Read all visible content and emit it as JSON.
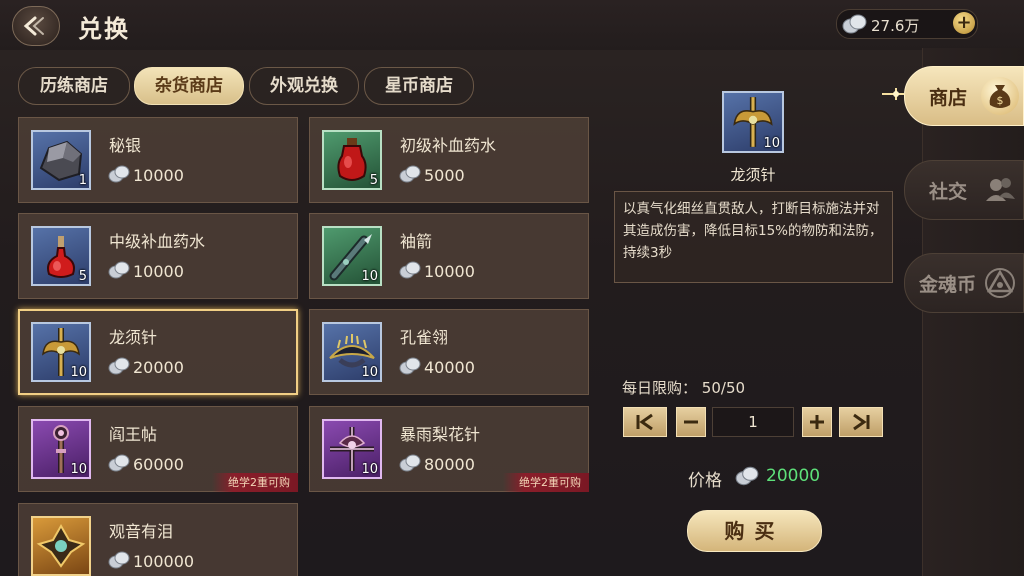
{
  "header": {
    "title": "兑换",
    "currency_amount": "27.6万"
  },
  "tabs": [
    {
      "label": "历练商店",
      "active": false
    },
    {
      "label": "杂货商店",
      "active": true
    },
    {
      "label": "外观兑换",
      "active": false
    },
    {
      "label": "星币商店",
      "active": false
    }
  ],
  "items": [
    {
      "name": "秘银",
      "price": "10000",
      "qty": "1",
      "rarity": "blue",
      "icon": "ore-icon",
      "selected": false,
      "lock": ""
    },
    {
      "name": "初级补血药水",
      "price": "5000",
      "qty": "5",
      "rarity": "green",
      "icon": "potion-icon",
      "selected": false,
      "lock": ""
    },
    {
      "name": "中级补血药水",
      "price": "10000",
      "qty": "5",
      "rarity": "blue",
      "icon": "potion-icon",
      "selected": false,
      "lock": ""
    },
    {
      "name": "袖箭",
      "price": "10000",
      "qty": "10",
      "rarity": "green",
      "icon": "sleeve-dart-icon",
      "selected": false,
      "lock": ""
    },
    {
      "name": "龙须针",
      "price": "20000",
      "qty": "10",
      "rarity": "blue",
      "icon": "needle-weapon-icon",
      "selected": true,
      "lock": ""
    },
    {
      "name": "孔雀翎",
      "price": "40000",
      "qty": "10",
      "rarity": "blue",
      "icon": "peacock-plume-icon",
      "selected": false,
      "lock": ""
    },
    {
      "name": "阎王帖",
      "price": "60000",
      "qty": "10",
      "rarity": "purple",
      "icon": "scepter-icon",
      "selected": false,
      "lock": "绝学2重可购"
    },
    {
      "name": "暴雨梨花针",
      "price": "80000",
      "qty": "10",
      "rarity": "purple",
      "icon": "needle-weapon-icon",
      "selected": false,
      "lock": "绝学2重可购"
    },
    {
      "name": "观音有泪",
      "price": "100000",
      "qty": "",
      "rarity": "orange",
      "icon": "ornament-icon",
      "selected": false,
      "lock": ""
    }
  ],
  "detail": {
    "name": "龙须针",
    "qty": "10",
    "description": "以真气化细丝直贯敌人，打断目标施法并对其造成伤害，降低目标15%的物防和法防，持续3秒",
    "daily_limit_label": "每日限购：",
    "daily_limit_value": "50/50",
    "quantity": "1",
    "price_label": "价格",
    "price_value": "20000",
    "buy_label": "购买"
  },
  "side_nav": [
    {
      "label": "商店",
      "active": true,
      "icon": "money-bag-icon"
    },
    {
      "label": "社交",
      "active": false,
      "icon": "people-icon"
    },
    {
      "label": "金魂币",
      "active": false,
      "icon": "triangle-emblem-icon"
    }
  ],
  "colors": {
    "price_green": "#5ee07a",
    "gold": "#f1cf85"
  }
}
